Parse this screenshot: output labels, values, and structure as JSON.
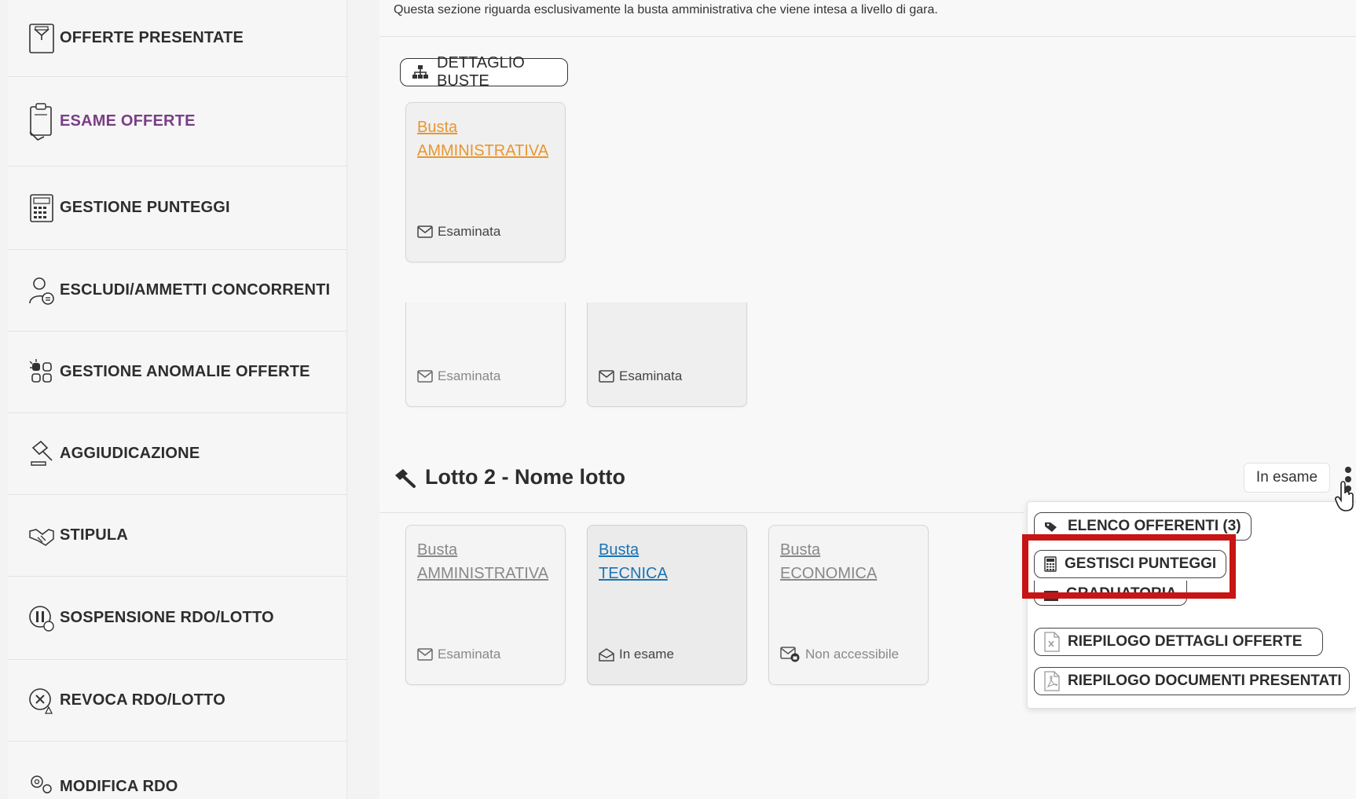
{
  "sidebar": {
    "items": [
      {
        "label": "OFFERTE PRESENTATE",
        "icon": "offers-icon"
      },
      {
        "label": "ESAME OFFERTE",
        "icon": "clipboard-icon",
        "active": true
      },
      {
        "label": "GESTIONE PUNTEGGI",
        "icon": "calculator-icon"
      },
      {
        "label": "ESCLUDI/AMMETTI CONCORRENTI",
        "icon": "users-icon"
      },
      {
        "label": "GESTIONE ANOMALIE OFFERTE",
        "icon": "anomaly-icon"
      },
      {
        "label": "AGGIUDICAZIONE",
        "icon": "gavel-icon"
      },
      {
        "label": "STIPULA",
        "icon": "handshake-icon"
      },
      {
        "label": "SOSPENSIONE RDO/LOTTO",
        "icon": "pause-icon"
      },
      {
        "label": "REVOCA RDO/LOTTO",
        "icon": "revoke-icon"
      },
      {
        "label": "MODIFICA RDO",
        "icon": "settings-icon"
      }
    ],
    "active_color": "#7a3e86"
  },
  "main": {
    "intro": "Questa sezione riguarda esclusivamente la busta amministrativa che viene intesa a livello di gara.",
    "detail_button": "DETTAGLIO BUSTE",
    "gara_card": {
      "title_line1": "Busta",
      "title_line2": "AMMINISTRATIVA",
      "status": "Esaminata",
      "color": "#e8962e"
    },
    "partial_cards": [
      {
        "status": "Esaminata"
      },
      {
        "status": "Esaminata"
      }
    ],
    "lotto": {
      "title": "Lotto 2 - Nome lotto",
      "badge": "In esame",
      "cards": [
        {
          "title_line1": "Busta",
          "title_line2": "AMMINISTRATIVA",
          "status": "Esaminata",
          "color": "#888888"
        },
        {
          "title_line1": "Busta",
          "title_line2": "TECNICA",
          "status": "In esame",
          "color": "#1a73b5"
        },
        {
          "title_line1": "Busta",
          "title_line2": "ECONOMICA",
          "status": "Non accessibile",
          "color": "#888888"
        }
      ]
    },
    "dropdown": {
      "items": [
        {
          "label": "ELENCO OFFERENTI (3)",
          "icon": "tags-icon"
        },
        {
          "label": "GESTISCI PUNTEGGI",
          "icon": "calculator-icon",
          "highlighted": true
        },
        {
          "label": "GRADUATORIA",
          "icon": "list-icon"
        },
        {
          "label": "RIEPILOGO DETTAGLI OFFERTE",
          "icon": "excel-file-icon"
        },
        {
          "label": "RIEPILOGO DOCUMENTI PRESENTATI",
          "icon": "pdf-file-icon"
        }
      ],
      "highlight_color": "#c81414"
    }
  }
}
